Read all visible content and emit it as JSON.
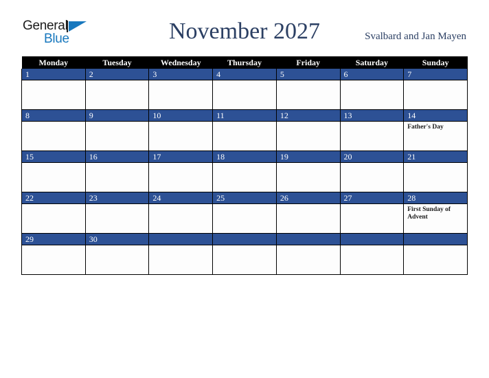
{
  "brand": {
    "name_part1": "General",
    "name_part2": "Blue",
    "triangle_color": "#1878be"
  },
  "header": {
    "title": "November 2027",
    "region": "Svalbard and Jan Mayen",
    "title_color": "#2b3f63"
  },
  "calendar": {
    "weekday_headers": [
      "Monday",
      "Tuesday",
      "Wednesday",
      "Thursday",
      "Friday",
      "Saturday",
      "Sunday"
    ],
    "header_bg": "#000000",
    "daynum_bg": "#2d5195",
    "weeks": [
      [
        {
          "day": "1",
          "events": []
        },
        {
          "day": "2",
          "events": []
        },
        {
          "day": "3",
          "events": []
        },
        {
          "day": "4",
          "events": []
        },
        {
          "day": "5",
          "events": []
        },
        {
          "day": "6",
          "events": []
        },
        {
          "day": "7",
          "events": []
        }
      ],
      [
        {
          "day": "8",
          "events": []
        },
        {
          "day": "9",
          "events": []
        },
        {
          "day": "10",
          "events": []
        },
        {
          "day": "11",
          "events": []
        },
        {
          "day": "12",
          "events": []
        },
        {
          "day": "13",
          "events": []
        },
        {
          "day": "14",
          "events": [
            "Father's Day"
          ]
        }
      ],
      [
        {
          "day": "15",
          "events": []
        },
        {
          "day": "16",
          "events": []
        },
        {
          "day": "17",
          "events": []
        },
        {
          "day": "18",
          "events": []
        },
        {
          "day": "19",
          "events": []
        },
        {
          "day": "20",
          "events": []
        },
        {
          "day": "21",
          "events": []
        }
      ],
      [
        {
          "day": "22",
          "events": []
        },
        {
          "day": "23",
          "events": []
        },
        {
          "day": "24",
          "events": []
        },
        {
          "day": "25",
          "events": []
        },
        {
          "day": "26",
          "events": []
        },
        {
          "day": "27",
          "events": []
        },
        {
          "day": "28",
          "events": [
            "First Sunday of Advent"
          ]
        }
      ],
      [
        {
          "day": "29",
          "events": []
        },
        {
          "day": "30",
          "events": []
        },
        {
          "day": "",
          "events": []
        },
        {
          "day": "",
          "events": []
        },
        {
          "day": "",
          "events": []
        },
        {
          "day": "",
          "events": []
        },
        {
          "day": "",
          "events": []
        }
      ]
    ]
  }
}
